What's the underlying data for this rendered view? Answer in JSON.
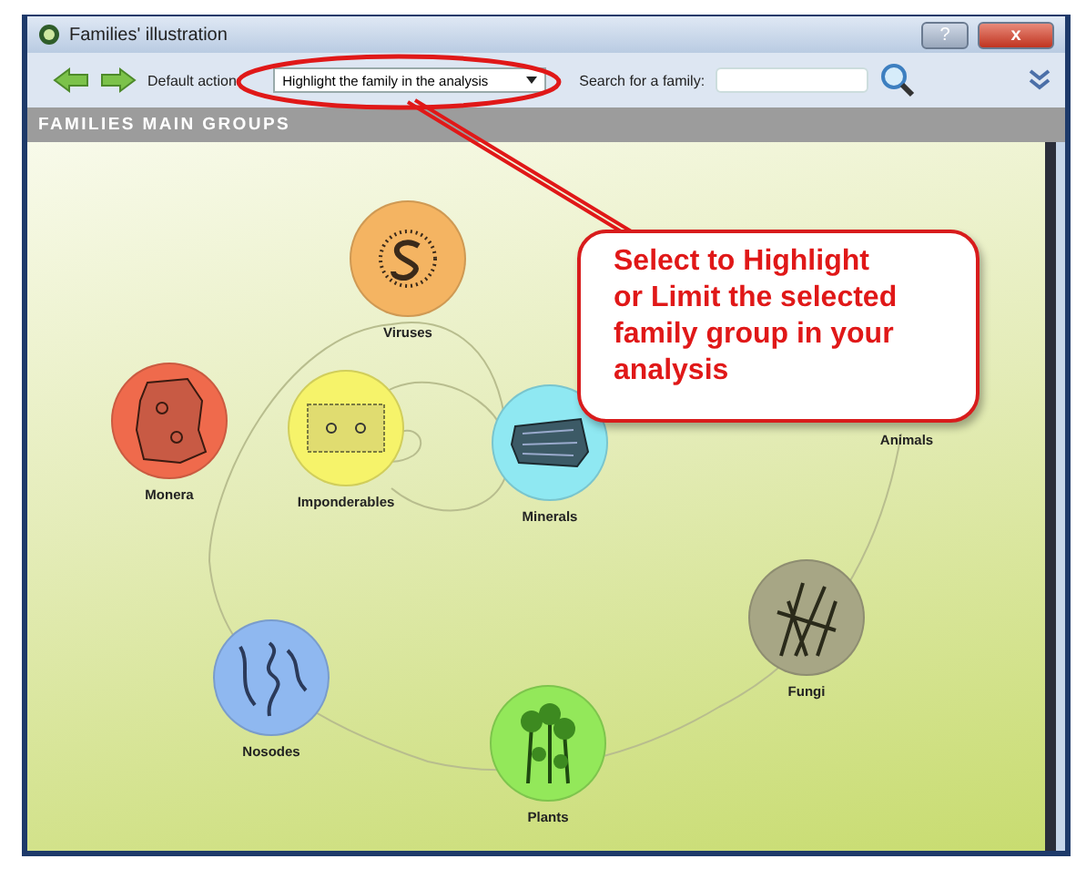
{
  "window": {
    "title": "Families' illustration",
    "help_button": "?",
    "close_button": "x"
  },
  "toolbar": {
    "default_action_label": "Default action:",
    "default_action_value": "Highlight the family in the analysis",
    "search_label": "Search for a family:"
  },
  "panel": {
    "header": "FAMILIES MAIN GROUPS",
    "groups": [
      {
        "label": "Viruses",
        "kind": "virus",
        "color": "#f4b462"
      },
      {
        "label": "Monera",
        "kind": "cell",
        "color": "#ef6a4c"
      },
      {
        "label": "Imponderables",
        "kind": "fibers",
        "color": "#f6f36a"
      },
      {
        "label": "Minerals",
        "kind": "rock",
        "color": "#8fe8f2"
      },
      {
        "label": "Animals",
        "kind": "covered"
      },
      {
        "label": "Fungi",
        "kind": "fungi",
        "color": "#a7a685"
      },
      {
        "label": "Nosodes",
        "kind": "worms",
        "color": "#8fb8f0"
      },
      {
        "label": "Plants",
        "kind": "plant",
        "color": "#93e85a"
      }
    ]
  },
  "annotation": {
    "callout": "Select to Highlight or Limit the selected family group in your analysis"
  }
}
